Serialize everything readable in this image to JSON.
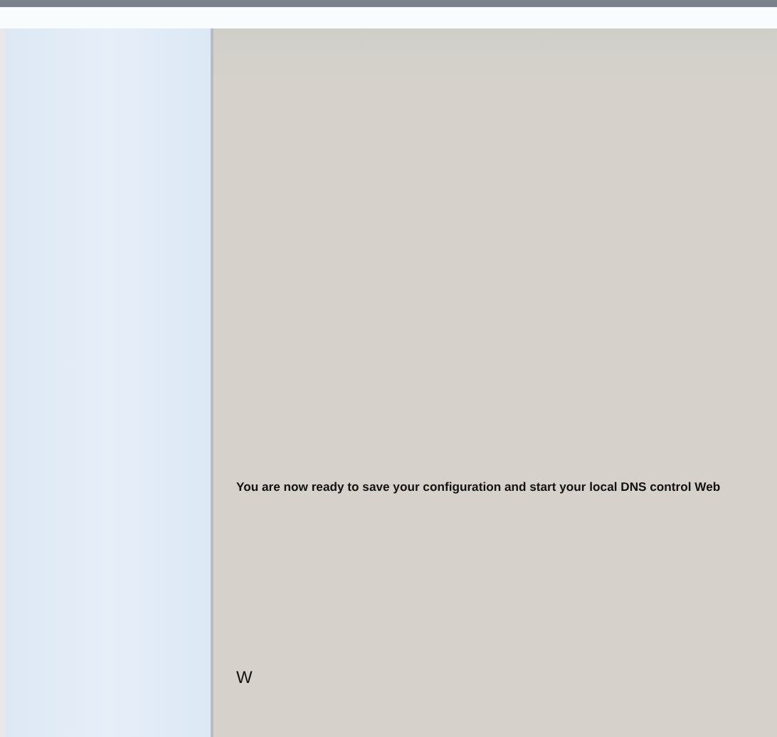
{
  "message": "You are now ready to save your configuration and start your local DNS control Web",
  "footer_text": "W"
}
